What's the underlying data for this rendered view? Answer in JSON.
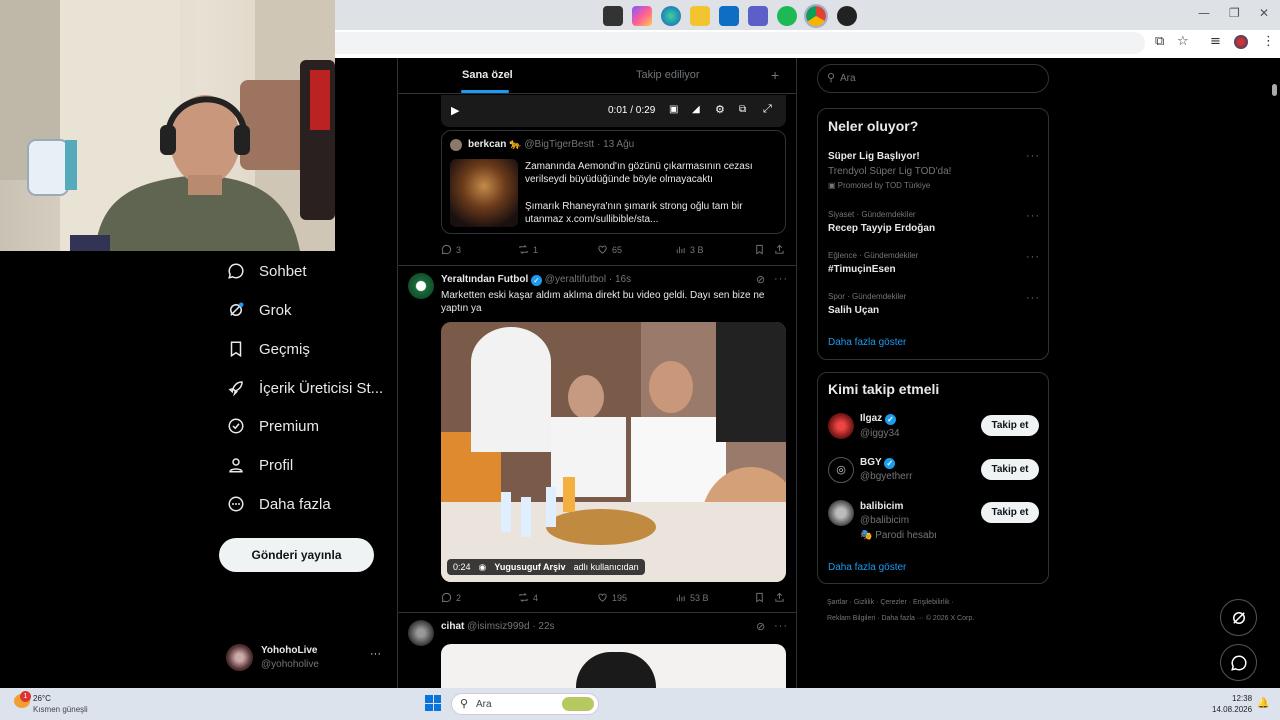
{
  "sidebar": {
    "items": [
      {
        "label": "Sohbet",
        "icon": "chat-bubble-icon"
      },
      {
        "label": "Grok",
        "icon": "grok-icon"
      },
      {
        "label": "Geçmiş",
        "icon": "bookmark-icon"
      },
      {
        "label": "İçerik Üreticisi St...",
        "icon": "rocket-icon"
      },
      {
        "label": "Premium",
        "icon": "verified-badge-icon"
      },
      {
        "label": "Profil",
        "icon": "person-icon"
      },
      {
        "label": "Daha fazla",
        "icon": "more-circle-icon"
      }
    ],
    "post_button": "Gönderi yayınla",
    "account": {
      "name": "YohohoLive",
      "handle": "@yohoholive",
      "menu": "···"
    }
  },
  "feed": {
    "tabs": [
      {
        "label": "Sana özel",
        "active": true
      },
      {
        "label": "Takip ediliyor",
        "active": false
      }
    ],
    "add_tab": "+",
    "video_player": {
      "time": "0:01 / 0:29"
    },
    "quote": {
      "name": "berkcan",
      "emoji": "🐆",
      "handle": "@BigTigerBestt",
      "date": "· 13 Ağu",
      "text1": "Zamanında Aemond'ın gözünü çıkarmasının cezası verilseydi büyüdüğünde böyle olmayacaktı",
      "text2": "Şımarık Rhaneyra'nın şımarık strong oğlu tam bir utanmaz  x.com/sullibible/sta..."
    },
    "actions1": {
      "replies": "3",
      "reposts": "1",
      "likes": "65",
      "views": "3 B"
    },
    "tweet2": {
      "name": "Yeraltından Futbol",
      "handle": "@yeraltifutbol",
      "time": "· 16s",
      "text": "Marketten eski kaşar aldım aklıma direkt bu video geldi. Dayı sen bize ne yaptın ya",
      "video_time": "0:24",
      "video_source": "Yugusuguf Arşiv",
      "video_source_suffix": "adlı kullanıcıdan",
      "actions": {
        "replies": "2",
        "reposts": "4",
        "likes": "195",
        "views": "53 B"
      }
    },
    "tweet3": {
      "name": "cihat",
      "handle": "@isimsiz999d",
      "time": "· 22s"
    }
  },
  "right": {
    "search_placeholder": "Ara",
    "trends": {
      "title": "Neler oluyor?",
      "items": [
        {
          "title": "Süper Lig Başlıyor!",
          "sub": "Trendyol Süper Lig TOD'da!",
          "promo": "Promoted by TOD Türkiye"
        },
        {
          "context": "Siyaset · Gündemdekiler",
          "title": "Recep Tayyip Erdoğan"
        },
        {
          "context": "Eğlence · Gündemdekiler",
          "title": "#TimuçinEsen"
        },
        {
          "context": "Spor · Gündemdekiler",
          "title": "Salih Uçan"
        }
      ],
      "more": "Daha fazla göster"
    },
    "who": {
      "title": "Kimi takip etmeli",
      "users": [
        {
          "name": "Ilgaz",
          "handle": "@iggy34",
          "verified": true,
          "button": "Takip et"
        },
        {
          "name": "BGY",
          "handle": "@bgyetherr",
          "verified": true,
          "button": "Takip et"
        },
        {
          "name": "balibicim",
          "handle": "@balibicim",
          "verified": false,
          "note": "Parodi hesabı",
          "button": "Takip et"
        }
      ],
      "more": "Daha fazla göster"
    },
    "footer": {
      "line1": [
        "Şartlar",
        "Gizlilik",
        "Çerezler",
        "Erişilebilirlik"
      ],
      "line2": [
        "Reklam Bilgileri",
        "Daha fazla ···",
        "© 2026 X Corp."
      ]
    }
  },
  "taskbar": {
    "weather_temp": "26°C",
    "weather_desc": "Kısmen güneşli",
    "badge": "1",
    "search": "Ara",
    "time": "12:38",
    "date": "14.08.2026"
  },
  "colors": {
    "accent": "#1d9bf0",
    "bg": "#000000",
    "border": "#2f3336",
    "muted": "#71767b"
  }
}
